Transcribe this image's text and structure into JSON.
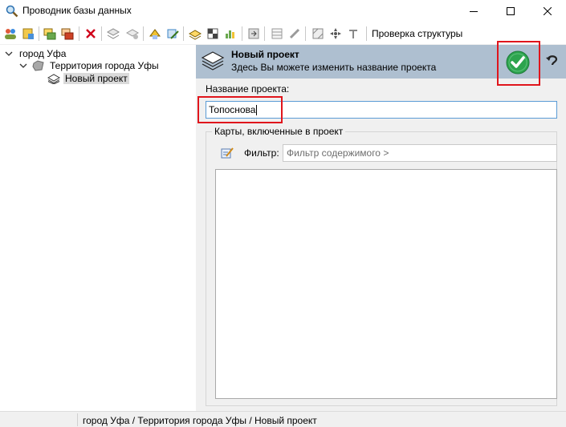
{
  "window": {
    "title": "Проводник базы данных"
  },
  "toolbar": {
    "structure_check_label": "Проверка структуры"
  },
  "tree": {
    "items": [
      {
        "label": "город Уфа"
      },
      {
        "label": "Территория города Уфы"
      },
      {
        "label": "Новый проект"
      }
    ]
  },
  "editor": {
    "title": "Новый проект",
    "subtitle": "Здесь Вы можете изменить название проекта",
    "name_label": "Название проекта:",
    "name_value": "Топоснова",
    "maps_group_label": "Карты, включенные в проект",
    "filter_label": "Фильтр:",
    "filter_placeholder": "Фильтр содержимого >"
  },
  "statusbar": {
    "path": "город Уфа / Территория города Уфы / Новый проект"
  },
  "colors": {
    "header_bg": "#aebfd0",
    "ok_green": "#2da44e",
    "highlight_red": "#e0151c",
    "selection": "#dadada"
  }
}
